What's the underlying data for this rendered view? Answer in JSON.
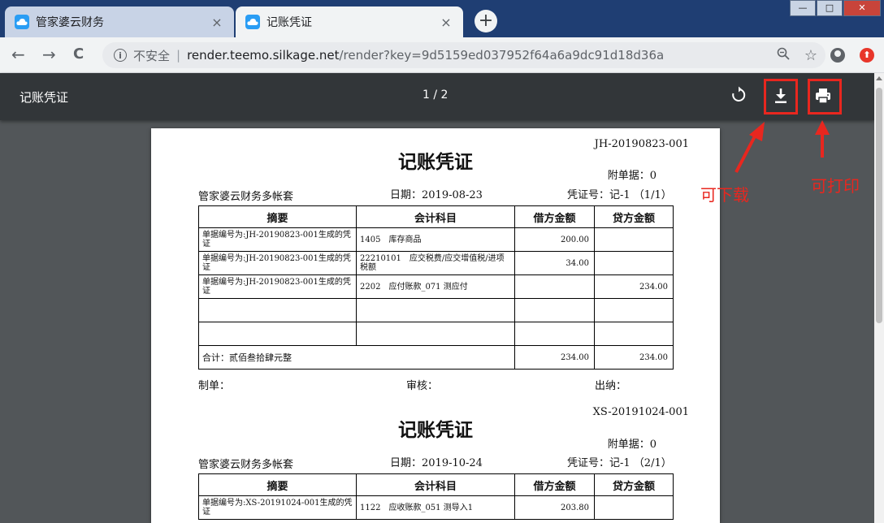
{
  "browser": {
    "tabs": [
      {
        "title": "管家婆云财务",
        "close": "×"
      },
      {
        "title": "记账凭证",
        "close": "×"
      }
    ],
    "new_tab": "+",
    "window_controls": {
      "minimize": "—",
      "maximize": "□",
      "close": "✕"
    },
    "nav": {
      "back": "←",
      "forward": "→",
      "reload": "C"
    },
    "address": {
      "security_label": "不安全",
      "host": "render.teemo.silkage.net",
      "path": "/render?key=9d5159ed037952f64a6a9dc91d18d36a"
    },
    "icons": [
      "zoom-icon",
      "star-icon",
      "profile-icon",
      "extension-icon"
    ]
  },
  "viewer": {
    "title": "记账凭证",
    "page_count": "1 / 2",
    "icons": [
      "rotate-icon",
      "download-icon",
      "print-icon"
    ],
    "highlight_color": "#e8271f"
  },
  "annotations": {
    "download": "可下载",
    "print": "可打印"
  },
  "vouchers": [
    {
      "number": "JH-20190823-001",
      "title": "记账凭证",
      "attachments": "附单据：0",
      "company": "管家婆云财务多帐套",
      "date": "日期：2019-08-23",
      "voucher_no": "凭证号：记-1 （1/1）",
      "headers": [
        "摘要",
        "会计科目",
        "借方金额",
        "贷方金额"
      ],
      "rows": [
        [
          "单据编号为:JH-20190823-001生成的凭证",
          "1405　库存商品",
          "200.00",
          ""
        ],
        [
          "单据编号为:JH-20190823-001生成的凭证",
          "22210101　应交税费/应交增值税/进项税额",
          "34.00",
          ""
        ],
        [
          "单据编号为:JH-20190823-001生成的凭证",
          "2202　应付账款_071 测应付",
          "",
          "234.00"
        ],
        [
          "",
          "",
          "",
          ""
        ],
        [
          "",
          "",
          "",
          ""
        ]
      ],
      "total": {
        "label": "合计：贰佰叁拾肆元整",
        "debit": "234.00",
        "credit": "234.00"
      },
      "footer": {
        "maker": "制单：",
        "reviewer": "审核：",
        "cashier": "出纳："
      }
    },
    {
      "number": "XS-20191024-001",
      "title": "记账凭证",
      "attachments": "附单据：0",
      "company": "管家婆云财务多帐套",
      "date": "日期：2019-10-24",
      "voucher_no": "凭证号：记-1 （2/1）",
      "headers": [
        "摘要",
        "会计科目",
        "借方金额",
        "贷方金额"
      ],
      "rows": [
        [
          "单据编号为:XS-20191024-001生成的凭证",
          "1122　应收账款_051 测导入1",
          "203.80",
          ""
        ]
      ]
    }
  ]
}
